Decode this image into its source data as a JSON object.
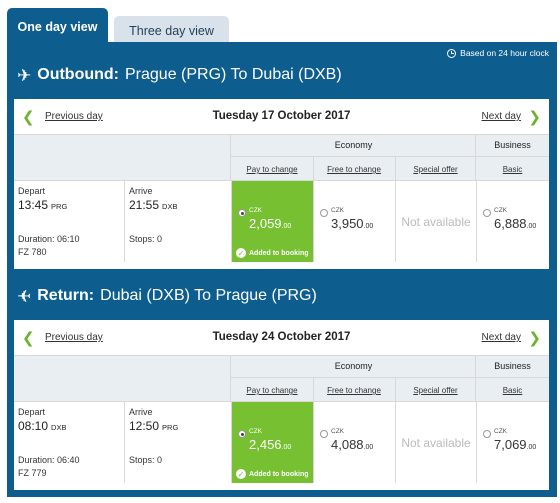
{
  "tabs": [
    {
      "label": "One day view",
      "active": true
    },
    {
      "label": "Three day view",
      "active": false
    }
  ],
  "clock_note": "Based on 24 hour clock",
  "legs": [
    {
      "kind": "Outbound:",
      "route": "Prague (PRG) To Dubai (DXB)",
      "prev_label": "Previous day",
      "next_label": "Next day",
      "date": "Tuesday 17 October 2017",
      "cabins": {
        "economy": "Economy",
        "business": "Business"
      },
      "fare_types": [
        "Pay to change",
        "Free to change",
        "Special offer",
        "Basic"
      ],
      "flight": {
        "depart_label": "Depart",
        "depart_time": "13:45",
        "depart_airport": "PRG",
        "arrive_label": "Arrive",
        "arrive_time": "21:55",
        "arrive_airport": "DXB",
        "duration": "Duration: 06:10",
        "stops": "Stops: 0",
        "flight_no": "FZ 780"
      },
      "fares": [
        {
          "currency": "CZK",
          "amount": "2,059",
          "decimals": ".00",
          "selected": true,
          "added_label": "Added to booking"
        },
        {
          "currency": "CZK",
          "amount": "3,950",
          "decimals": ".00",
          "selected": false
        },
        {
          "not_available": "Not available"
        },
        {
          "currency": "CZK",
          "amount": "6,888",
          "decimals": ".00",
          "selected": false
        }
      ]
    },
    {
      "kind": "Return:",
      "route": "Dubai (DXB) To Prague (PRG)",
      "prev_label": "Previous day",
      "next_label": "Next day",
      "date": "Tuesday 24 October 2017",
      "cabins": {
        "economy": "Economy",
        "business": "Business"
      },
      "fare_types": [
        "Pay to change",
        "Free to change",
        "Special offer",
        "Basic"
      ],
      "flight": {
        "depart_label": "Depart",
        "depart_time": "08:10",
        "depart_airport": "DXB",
        "arrive_label": "Arrive",
        "arrive_time": "12:50",
        "arrive_airport": "PRG",
        "duration": "Duration: 06:40",
        "stops": "Stops: 0",
        "flight_no": "FZ 779"
      },
      "fares": [
        {
          "currency": "CZK",
          "amount": "2,456",
          "decimals": ".00",
          "selected": true,
          "added_label": "Added to booking"
        },
        {
          "currency": "CZK",
          "amount": "4,088",
          "decimals": ".00",
          "selected": false
        },
        {
          "not_available": "Not available"
        },
        {
          "currency": "CZK",
          "amount": "7,069",
          "decimals": ".00",
          "selected": false
        }
      ]
    }
  ],
  "colors": {
    "panel": "#0e5d8f",
    "selected": "#76c032",
    "arrow": "#6ab42d"
  }
}
